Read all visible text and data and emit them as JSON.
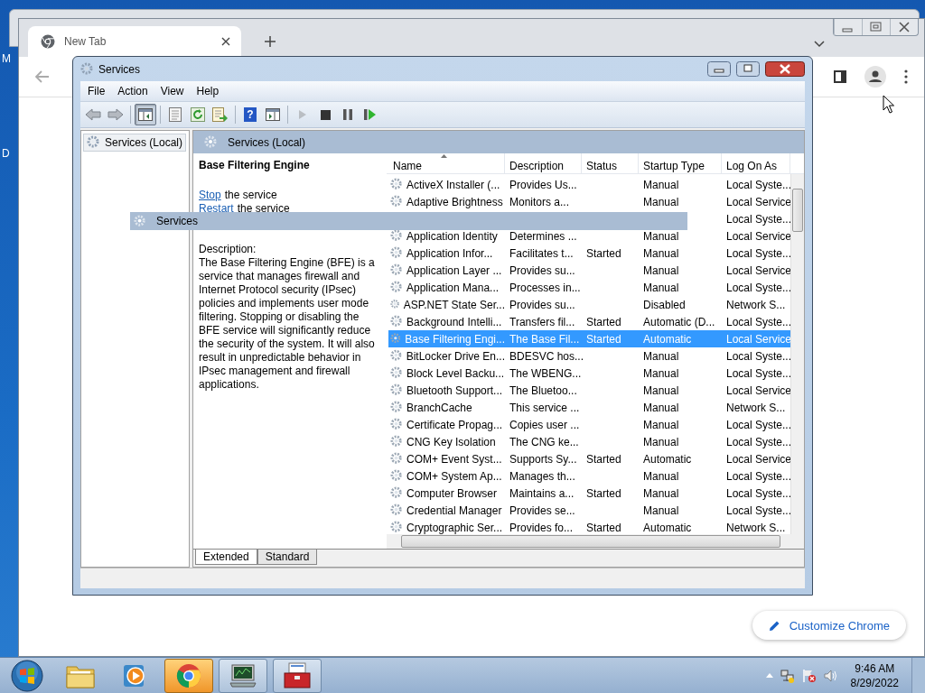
{
  "desktop": {
    "labels": [
      "M",
      "D"
    ]
  },
  "browser": {
    "tabs": [
      {
        "title": "New Tab",
        "selected": true
      }
    ],
    "customize_button": "Customize Chrome"
  },
  "services_window": {
    "title": "Services",
    "menu": [
      "File",
      "Action",
      "View",
      "Help"
    ],
    "toolbar_groups": [
      [
        {
          "kind": "back",
          "pressed": false,
          "disabled": false
        },
        {
          "kind": "forward",
          "pressed": false,
          "disabled": false
        }
      ],
      [
        {
          "kind": "console-tree",
          "pressed": true,
          "disabled": false
        }
      ],
      [
        {
          "kind": "properties",
          "pressed": false,
          "disabled": false
        },
        {
          "kind": "refresh",
          "pressed": false,
          "disabled": false
        },
        {
          "kind": "export",
          "pressed": false,
          "disabled": false
        }
      ],
      [
        {
          "kind": "help",
          "glyph": "?",
          "pressed": false,
          "disabled": false
        },
        {
          "kind": "action-pane",
          "pressed": false,
          "disabled": false
        }
      ],
      [
        {
          "kind": "start",
          "pressed": false,
          "disabled": true
        },
        {
          "kind": "stop",
          "pressed": false,
          "disabled": false
        },
        {
          "kind": "pause",
          "pressed": false,
          "disabled": false
        },
        {
          "kind": "resume",
          "pressed": false,
          "disabled": false
        }
      ]
    ],
    "tree": [
      {
        "label": "Services (Local)",
        "selected": true
      }
    ],
    "pane_header": "Services (Local)",
    "details": {
      "title": "Base Filtering Engine",
      "actions": [
        {
          "link": "Stop",
          "text": "the service"
        },
        {
          "link": "Restart",
          "text": "the service"
        }
      ],
      "description_label": "Description:",
      "description": "The Base Filtering Engine (BFE) is a service that manages firewall and Internet Protocol security (IPsec) policies and implements user mode filtering. Stopping or disabling the BFE service will significantly reduce the security of the system. It will also result in unpredictable behavior in IPsec management and firewall applications."
    },
    "table": {
      "columns": [
        {
          "label": "Name",
          "sorted": true
        },
        {
          "label": "Description",
          "sorted": false
        },
        {
          "label": "Status",
          "sorted": false
        },
        {
          "label": "Startup Type",
          "sorted": false
        },
        {
          "label": "Log On As",
          "sorted": false
        }
      ],
      "rows": [
        {
          "name": "ActiveX Installer (...",
          "description": "Provides Us...",
          "startup_type": "Manual",
          "log_on_as": "Local Syste...",
          "selected": false
        },
        {
          "name": "Adaptive Brightness",
          "description": "Monitors a...",
          "startup_type": "Manual",
          "log_on_as": "Local Service",
          "selected": false
        },
        {
          "log_on_as": "Local Syste...",
          "selected": false
        },
        {
          "name": "Application Identity",
          "description": "Determines ...",
          "startup_type": "Manual",
          "log_on_as": "Local Service",
          "selected": false
        },
        {
          "name": "Application Infor...",
          "description": "Facilitates t...",
          "status": "Started",
          "startup_type": "Manual",
          "log_on_as": "Local Syste...",
          "selected": false
        },
        {
          "name": "Application Layer ...",
          "description": "Provides su...",
          "startup_type": "Manual",
          "log_on_as": "Local Service",
          "selected": false
        },
        {
          "name": "Application Mana...",
          "description": "Processes in...",
          "startup_type": "Manual",
          "log_on_as": "Local Syste...",
          "selected": false
        },
        {
          "name": "ASP.NET State Ser...",
          "description": "Provides su...",
          "startup_type": "Disabled",
          "log_on_as": "Network S...",
          "selected": false
        },
        {
          "name": "Background Intelli...",
          "description": "Transfers fil...",
          "status": "Started",
          "startup_type": "Automatic (D...",
          "log_on_as": "Local Syste...",
          "selected": false
        },
        {
          "name": "Base Filtering Engi...",
          "description": "The Base Fil...",
          "status": "Started",
          "startup_type": "Automatic",
          "log_on_as": "Local Service",
          "selected": true
        },
        {
          "name": "BitLocker Drive En...",
          "description": "BDESVC hos...",
          "startup_type": "Manual",
          "log_on_as": "Local Syste...",
          "selected": false
        },
        {
          "name": "Block Level Backu...",
          "description": "The WBENG...",
          "startup_type": "Manual",
          "log_on_as": "Local Syste...",
          "selected": false
        },
        {
          "name": "Bluetooth Support...",
          "description": "The Bluetoo...",
          "startup_type": "Manual",
          "log_on_as": "Local Service",
          "selected": false
        },
        {
          "name": "BranchCache",
          "description": "This service ...",
          "startup_type": "Manual",
          "log_on_as": "Network S...",
          "selected": false
        },
        {
          "name": "Certificate Propag...",
          "description": "Copies user ...",
          "startup_type": "Manual",
          "log_on_as": "Local Syste...",
          "selected": false
        },
        {
          "name": "CNG Key Isolation",
          "description": "The CNG ke...",
          "startup_type": "Manual",
          "log_on_as": "Local Syste...",
          "selected": false
        },
        {
          "name": "COM+ Event Syst...",
          "description": "Supports Sy...",
          "status": "Started",
          "startup_type": "Automatic",
          "log_on_as": "Local Service",
          "selected": false
        },
        {
          "name": "COM+ System Ap...",
          "description": "Manages th...",
          "startup_type": "Manual",
          "log_on_as": "Local Syste...",
          "selected": false
        },
        {
          "name": "Computer Browser",
          "description": "Maintains a...",
          "status": "Started",
          "startup_type": "Manual",
          "log_on_as": "Local Syste...",
          "selected": false
        },
        {
          "name": "Credential Manager",
          "description": "Provides se...",
          "startup_type": "Manual",
          "log_on_as": "Local Syste...",
          "selected": false
        },
        {
          "name": "Cryptographic Ser...",
          "description": "Provides fo...",
          "status": "Started",
          "startup_type": "Automatic",
          "log_on_as": "Network S...",
          "selected": false
        }
      ]
    },
    "view_tabs": [
      {
        "label": "Extended",
        "selected": true
      },
      {
        "label": "Standard",
        "selected": false
      }
    ],
    "drag_ghost": {
      "label": "Services"
    }
  },
  "taskbar": {
    "apps": [
      {
        "kind": "folder",
        "running": false,
        "active": false
      },
      {
        "kind": "media-player",
        "running": false,
        "active": false
      },
      {
        "kind": "chrome",
        "running": true,
        "active": true
      },
      {
        "kind": "monitor",
        "running": true,
        "active": false
      },
      {
        "kind": "toolbox",
        "running": true,
        "active": false
      }
    ],
    "clock": {
      "time": "9:46 AM",
      "date": "8/29/2022"
    }
  }
}
